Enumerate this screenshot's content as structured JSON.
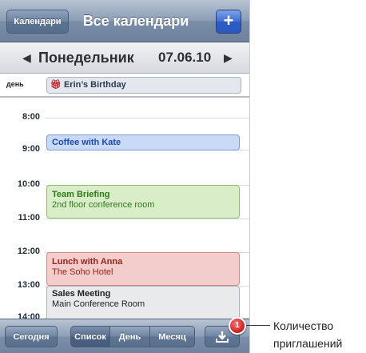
{
  "navbar": {
    "back_label": "Календари",
    "title": "Все календари",
    "add_label": "+"
  },
  "date": {
    "prev_arrow": "◀",
    "weekday": "Понедельник",
    "value": "07.06.10",
    "next_arrow": "▶"
  },
  "all_day": {
    "label": "день",
    "event_icon": "gift-icon",
    "event_title": "Erin’s Birthday"
  },
  "times": [
    "8:00",
    "9:00",
    "10:00",
    "11:00",
    "12:00",
    "13:00",
    "14:00"
  ],
  "events": [
    {
      "title": "Coffee with Kate",
      "subtitle": ""
    },
    {
      "title": "Team Briefing",
      "subtitle": "2nd floor conference room"
    },
    {
      "title": "Lunch with Anna",
      "subtitle": "The Soho Hotel"
    },
    {
      "title": "Sales Meeting",
      "subtitle": "Main Conference Room"
    }
  ],
  "toolbar": {
    "today_label": "Сегодня",
    "list_label": "Список",
    "day_label": "День",
    "month_label": "Месяц",
    "inbox_icon": "download-tray-icon"
  },
  "badge": {
    "count": "1"
  },
  "callout": {
    "text": "Количество приглашений"
  },
  "colors": {
    "blue": "#cad9f5",
    "green": "#d9eec8",
    "red": "#f2cdcb",
    "gray": "#e9eaec",
    "badge": "#d31818"
  }
}
